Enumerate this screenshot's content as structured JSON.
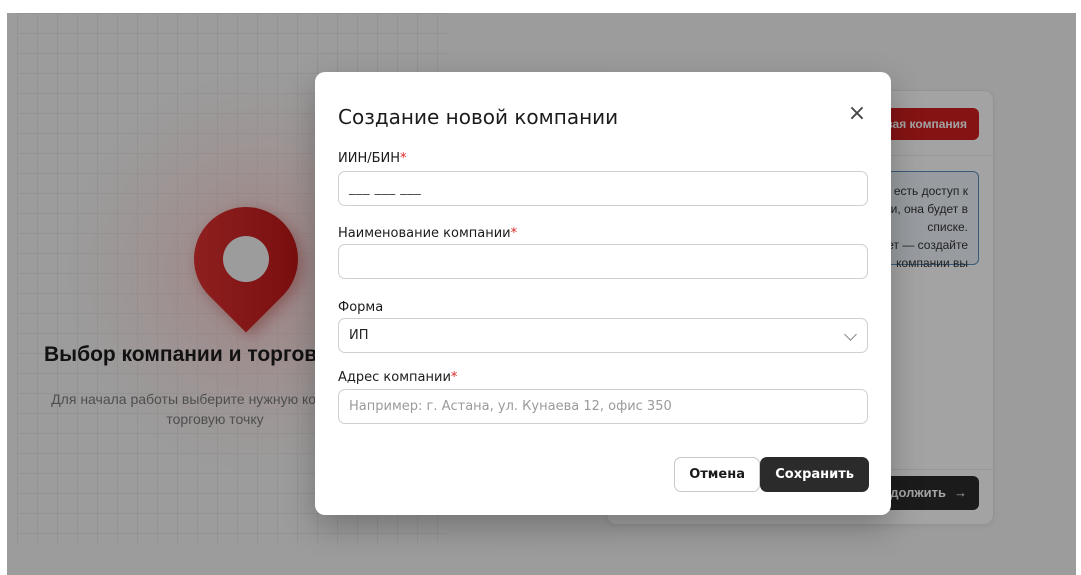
{
  "background": {
    "hero_title": "Выбор компании и торговой точки",
    "hero_subtitle_line1": "Для начала работы выберите нужную компанию и",
    "hero_subtitle_line2": "торговую точку",
    "new_company_button": "Новая компания",
    "info_line1": "Если у вас есть доступ к",
    "info_line2": "компании, она будет в списке.",
    "info_line3": "Если нет — создайте компании вы",
    "continue_button": "Продолжить",
    "continue_arrow": "→",
    "accent_color": "#d11f1f"
  },
  "modal": {
    "title": "Создание новой компании",
    "close_icon": "×",
    "iin": {
      "label": "ИИН/БИН",
      "required_mark": "*",
      "value": "___ ___ ___"
    },
    "name": {
      "label": "Наименование компании",
      "required_mark": "*",
      "value": ""
    },
    "form": {
      "label": "Форма",
      "value": "ИП"
    },
    "address": {
      "label": "Адрес компании",
      "required_mark": "*",
      "placeholder": "Например: г. Астана, ул. Кунаева 12, офис 350"
    },
    "cancel_button": "Отмена",
    "save_button": "Сохранить"
  }
}
